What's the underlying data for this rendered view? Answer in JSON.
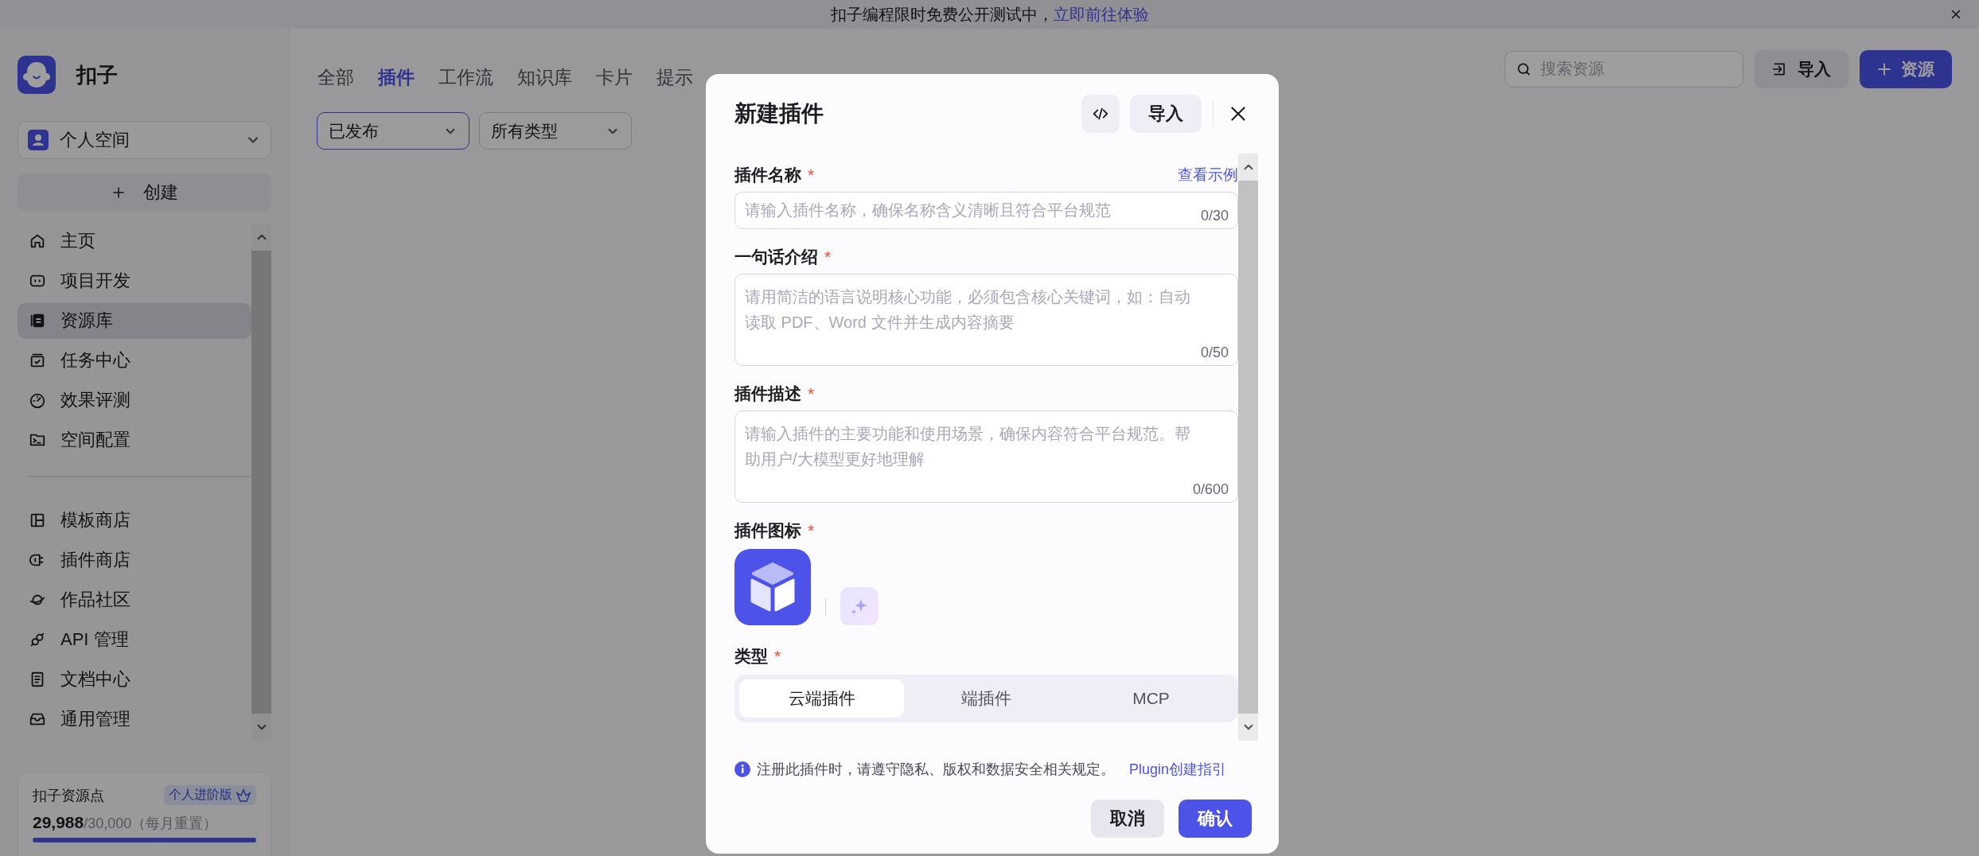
{
  "banner": {
    "text": "扣子编程限时免费公开测试中，",
    "link": "立即前往体验"
  },
  "sidebar": {
    "brand": "扣子",
    "space": "个人空间",
    "create_button": "创建",
    "nav_groups": [
      [
        {
          "label": "主页",
          "selected": false
        },
        {
          "label": "项目开发",
          "selected": false
        },
        {
          "label": "资源库",
          "selected": true
        },
        {
          "label": "任务中心",
          "selected": false
        },
        {
          "label": "效果评测",
          "selected": false
        },
        {
          "label": "空间配置",
          "selected": false
        }
      ],
      [
        {
          "label": "模板商店",
          "selected": false
        },
        {
          "label": "插件商店",
          "selected": false
        },
        {
          "label": "作品社区",
          "selected": false
        },
        {
          "label": "API 管理",
          "selected": false
        },
        {
          "label": "文档中心",
          "selected": false
        },
        {
          "label": "通用管理",
          "selected": false
        }
      ]
    ],
    "resource_card": {
      "title": "扣子资源点",
      "badge": "个人进阶版",
      "used": "29,988",
      "total": "/30,000",
      "note": "（每月重置）",
      "level": 0.9996
    }
  },
  "main": {
    "tabs": [
      {
        "label": "全部",
        "selected": false
      },
      {
        "label": "插件",
        "selected": true
      },
      {
        "label": "工作流",
        "selected": false
      },
      {
        "label": "知识库",
        "selected": false
      },
      {
        "label": "卡片",
        "selected": false
      },
      {
        "label": "提示",
        "selected": false
      }
    ],
    "filters": [
      {
        "value": "已发布",
        "active": true
      },
      {
        "value": "所有类型",
        "active": false
      }
    ],
    "search": {
      "placeholder": "搜索资源"
    },
    "import_button": "导入",
    "add_button": "资源"
  },
  "modal": {
    "title": "新建插件",
    "import_button": "导入",
    "fields": [
      {
        "label": "插件名称",
        "required_mark": "*",
        "link": "查看示例",
        "kind": "input",
        "placeholder": "请输入插件名称，确保名称含义清晰且符合平台规范",
        "counter": "0/30"
      },
      {
        "label": "一句话介绍",
        "required_mark": "*",
        "kind": "textarea",
        "placeholder": "请用简洁的语言说明核心功能，必须包含核心关键词，如：自动读取 PDF、Word 文件并生成内容摘要",
        "counter": "0/50"
      },
      {
        "label": "插件描述",
        "required_mark": "*",
        "kind": "textarea",
        "placeholder": "请输入插件的主要功能和使用场景，确保内容符合平台规范。帮助用户/大模型更好地理解",
        "counter": "0/600"
      }
    ],
    "icon_field": {
      "label": "插件图标",
      "required_mark": "*"
    },
    "type_field": {
      "label": "类型",
      "required_mark": "*",
      "options": [
        {
          "label": "云端插件",
          "selected": true
        },
        {
          "label": "端插件",
          "selected": false
        },
        {
          "label": "MCP",
          "selected": false
        }
      ]
    },
    "notice": {
      "text": "注册此插件时，请遵守隐私、版权和数据安全相关规定。",
      "link": "Plugin创建指引"
    },
    "cancel_button": "取消",
    "confirm_button": "确认"
  }
}
